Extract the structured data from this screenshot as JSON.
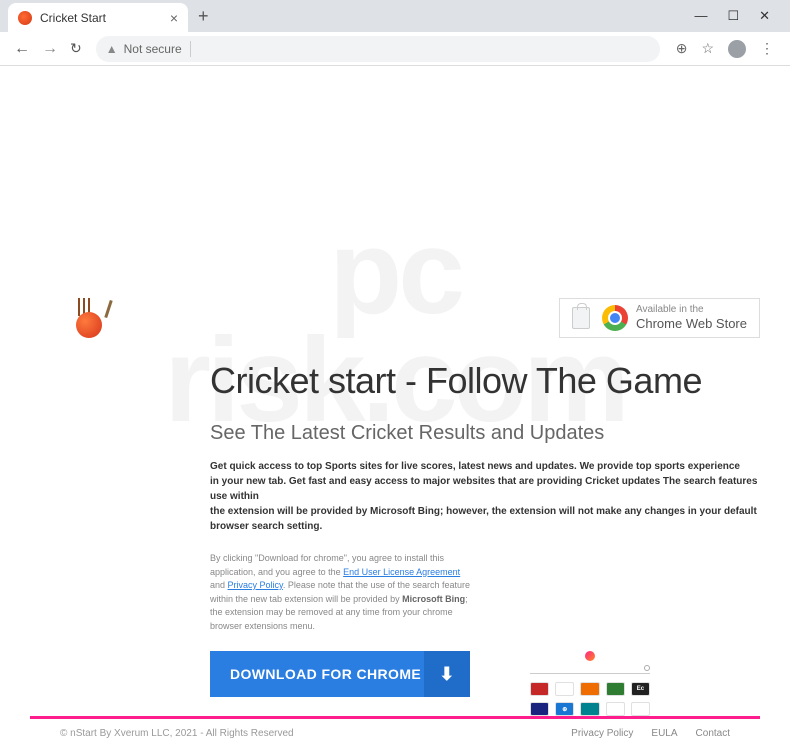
{
  "browser": {
    "tab_title": "Cricket Start",
    "address_warning": "Not secure",
    "window_min": "—",
    "window_max": "☐",
    "window_close": "✕"
  },
  "store_badge": {
    "line1": "Available in the",
    "line2": "Chrome Web Store"
  },
  "page": {
    "title": "Cricket start - Follow The Game",
    "subtitle": "See The Latest Cricket Results and Updates",
    "desc_l1": "Get quick access to top Sports sites for live scores, latest news and updates. We provide top sports experience",
    "desc_l2": "in your new tab. Get fast and easy access to major websites that are providing Cricket updates The search features use within",
    "desc_l3": "the extension will be provided by Microsoft Bing; however, the extension will not make any changes in your default browser search setting.",
    "disc_1": "By clicking \"Download for chrome\", you agree to install this application, and you agree to the ",
    "disc_eula": "End User License Agreement",
    "disc_and": " and ",
    "disc_pp": "Privacy Policy",
    "disc_2": ". Please note that the use of the search feature within the new tab extension will be provided by ",
    "disc_bing": "Microsoft Bing",
    "disc_3": "; the extension may be removed at any time from your chrome browser extensions menu.",
    "download_label": "DOWNLOAD FOR CHROME",
    "download_icon": "⬇"
  },
  "footer": {
    "copyright": "© nStart By Xverum LLC, 2021 - All Rights Reserved",
    "links": {
      "privacy": "Privacy Policy",
      "eula": "EULA",
      "contact": "Contact"
    }
  },
  "watermark": {
    "l1": "pc",
    "l2": "risk.com"
  },
  "colors": {
    "accent": "#2a7de1",
    "footer_bar": "#ff1d8e"
  }
}
